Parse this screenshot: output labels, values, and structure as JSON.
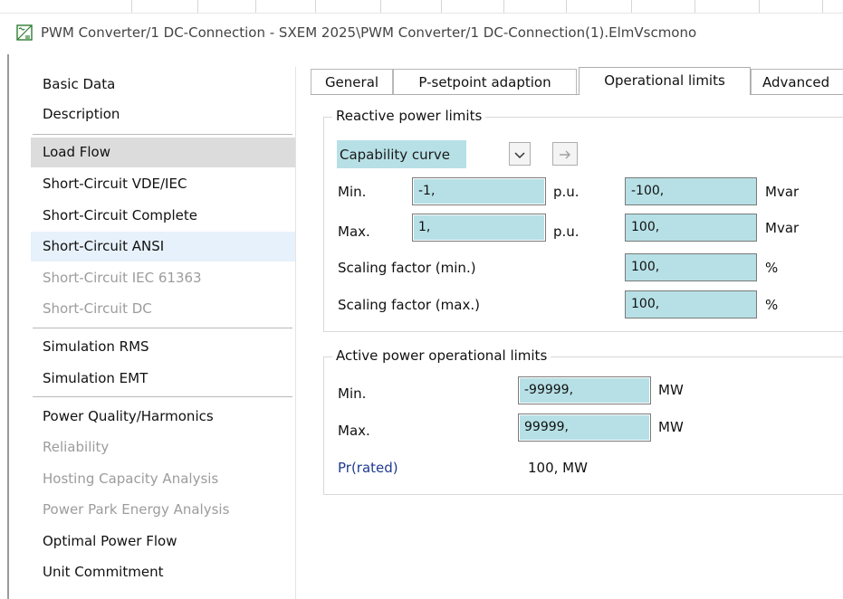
{
  "window": {
    "title": "PWM Converter/1 DC-Connection - SXEM 2025\\PWM Converter/1 DC-Connection(1).ElmVscmono",
    "icon": "converter-icon"
  },
  "sidebar": {
    "items": [
      {
        "label": "Basic Data",
        "state": "normal"
      },
      {
        "label": "Description",
        "state": "normal"
      },
      {
        "label": "Load Flow",
        "state": "selected"
      },
      {
        "label": "Short-Circuit VDE/IEC",
        "state": "normal"
      },
      {
        "label": "Short-Circuit Complete",
        "state": "normal"
      },
      {
        "label": "Short-Circuit ANSI",
        "state": "hover"
      },
      {
        "label": "Short-Circuit IEC 61363",
        "state": "disabled"
      },
      {
        "label": "Short-Circuit DC",
        "state": "disabled"
      },
      {
        "label": "Simulation RMS",
        "state": "normal"
      },
      {
        "label": "Simulation EMT",
        "state": "normal"
      },
      {
        "label": "Power Quality/Harmonics",
        "state": "normal"
      },
      {
        "label": "Reliability",
        "state": "disabled"
      },
      {
        "label": "Hosting Capacity Analysis",
        "state": "disabled"
      },
      {
        "label": "Power Park Energy Analysis",
        "state": "disabled"
      },
      {
        "label": "Optimal Power Flow",
        "state": "normal"
      },
      {
        "label": "Unit Commitment",
        "state": "normal"
      }
    ]
  },
  "tabs": [
    {
      "label": "General",
      "active": false
    },
    {
      "label": "P-setpoint adaption",
      "active": false
    },
    {
      "label": "Operational limits",
      "active": true
    },
    {
      "label": "Advanced",
      "active": false
    }
  ],
  "reactive": {
    "title": "Reactive power limits",
    "mode_select": {
      "value": "Capability curve",
      "dropdown_icon": "chevron-down-icon",
      "goto_icon": "arrow-right-icon"
    },
    "min_label": "Min.",
    "min_pu": "-1,",
    "max_label": "Max.",
    "max_pu": "1,",
    "pu_unit": "p.u.",
    "min_mvar": "-100,",
    "max_mvar": "100,",
    "mvar_unit": "Mvar",
    "scale_min_label": "Scaling factor (min.)",
    "scale_min_value": "100,",
    "scale_max_label": "Scaling factor (max.)",
    "scale_max_value": "100,",
    "percent_unit": "%"
  },
  "active": {
    "title": "Active power operational limits",
    "min_label": "Min.",
    "min_value": "-99999,",
    "max_label": "Max.",
    "max_value": "99999,",
    "mw_unit": "MW",
    "rated_label": "Pr(rated)",
    "rated_value": "100, MW"
  },
  "colors": {
    "field_bg": "#b6e0e6",
    "selected_bg": "#dcdcdc",
    "hover_bg": "#e7f1fb",
    "link_blue": "#1f3b8f"
  }
}
